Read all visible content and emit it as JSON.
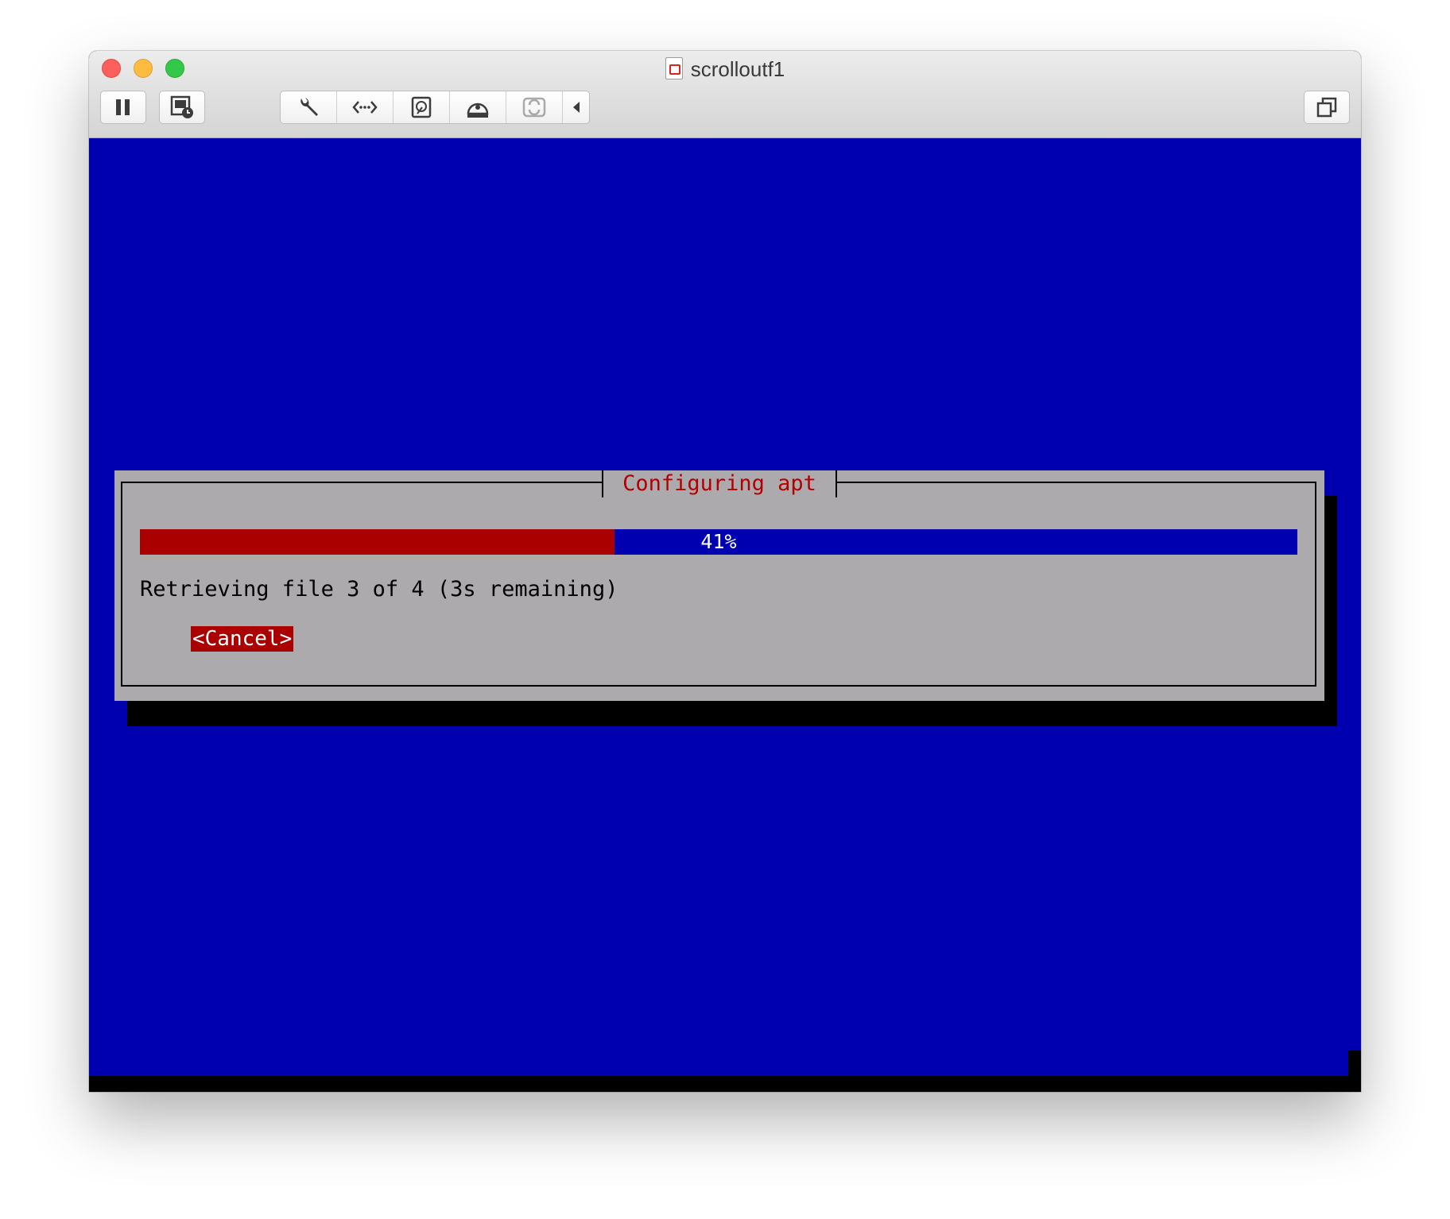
{
  "window": {
    "title": "scrolloutf1"
  },
  "toolbar": {
    "left_buttons": [
      "pause-icon",
      "snapshot-icon"
    ],
    "group_buttons": [
      "wrench-icon",
      "network-icon",
      "hard-disk-icon",
      "optical-disk-icon",
      "usb-icon",
      "collapse-arrow-icon"
    ],
    "right_buttons": [
      "window-mode-icon"
    ]
  },
  "dialog": {
    "title": "Configuring apt",
    "progress_percent": 41,
    "progress_label": "41%",
    "message": "Retrieving file 3 of 4 (3s remaining)",
    "cancel_label": "<Cancel>"
  },
  "colors": {
    "screen_bg": "#0000b0",
    "dialog_bg": "#adaaad",
    "accent_red": "#aa0000",
    "title_red": "#b20000"
  }
}
